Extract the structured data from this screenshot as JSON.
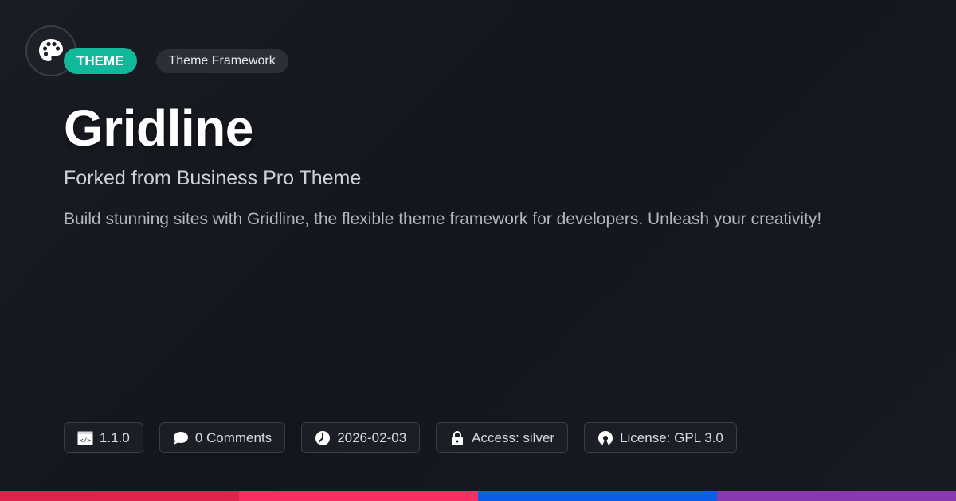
{
  "tags": {
    "primary": "THEME",
    "secondary": "Theme Framework"
  },
  "title": "Gridline",
  "subtitle": "Forked from Business Pro Theme",
  "description": "Build stunning sites with Gridline, the flexible theme framework for developers. Unleash your creativity!",
  "meta": {
    "version": "1.1.0",
    "comments": "0 Comments",
    "date": "2026-02-03",
    "access": "Access: silver",
    "license": "License: GPL 3.0"
  },
  "icons": {
    "logo": "palette-icon",
    "version": "code-window-icon",
    "comments": "speech-bubble-icon",
    "date": "clock-icon",
    "access": "lock-icon",
    "license": "open-source-icon"
  },
  "colors": {
    "accent": "#12b89a",
    "stripes": [
      "#e0224f",
      "#fb2e64",
      "#0a5fe8",
      "#8a3ab0"
    ]
  }
}
